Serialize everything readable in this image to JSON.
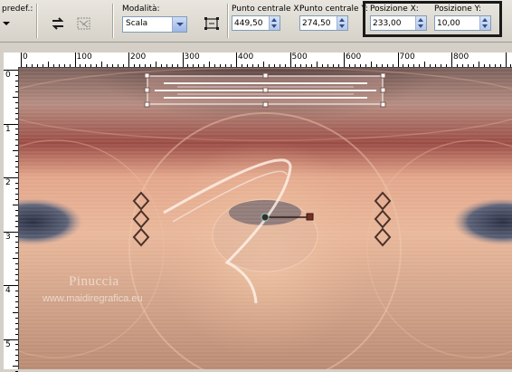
{
  "toolbar": {
    "preset_label": "predef.:",
    "mode_label": "Modalità:",
    "mode_value": "Scala",
    "center_x_label": "Punto centrale X:",
    "center_x_value": "449,50",
    "center_y_label": "Punto centrale Y:",
    "center_y_value": "274,50",
    "pos_x_label": "Posizione X:",
    "pos_x_value": "233,00",
    "pos_y_label": "Posizione Y:",
    "pos_y_value": "10,00"
  },
  "ruler_top": {
    "labels": [
      "0",
      "100",
      "200",
      "300",
      "400",
      "500",
      "600",
      "700",
      "800"
    ]
  },
  "ruler_left": {
    "labels": [
      "0",
      "1",
      "2",
      "3",
      "4",
      "5"
    ]
  },
  "watermark": {
    "name": "Pinuccia",
    "site": "www.maidiregrafica.eu"
  },
  "colors": {
    "accent_box": "#1a1a1a",
    "ruler_bg": "#ffffff",
    "field_border": "#7f9db9"
  }
}
